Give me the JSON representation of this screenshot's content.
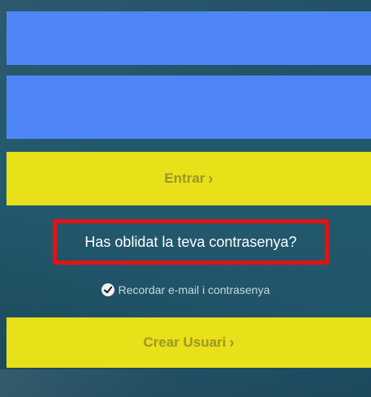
{
  "form": {
    "email_value": "",
    "password_value": "",
    "login_label": "Entrar",
    "forgot_label": "Has oblidat la teva contrasenya?",
    "remember_label": "Recordar e-mail i contrasenya",
    "remember_checked": true,
    "create_label": "Crear Usuari"
  },
  "icons": {
    "chevron": "chevron-right-icon",
    "check": "check-icon"
  },
  "colors": {
    "input_bg": "#4e86f7",
    "button_bg": "#e8e018",
    "button_text": "#9a9728",
    "highlight_border": "#e41212",
    "background": "#1f5166"
  }
}
